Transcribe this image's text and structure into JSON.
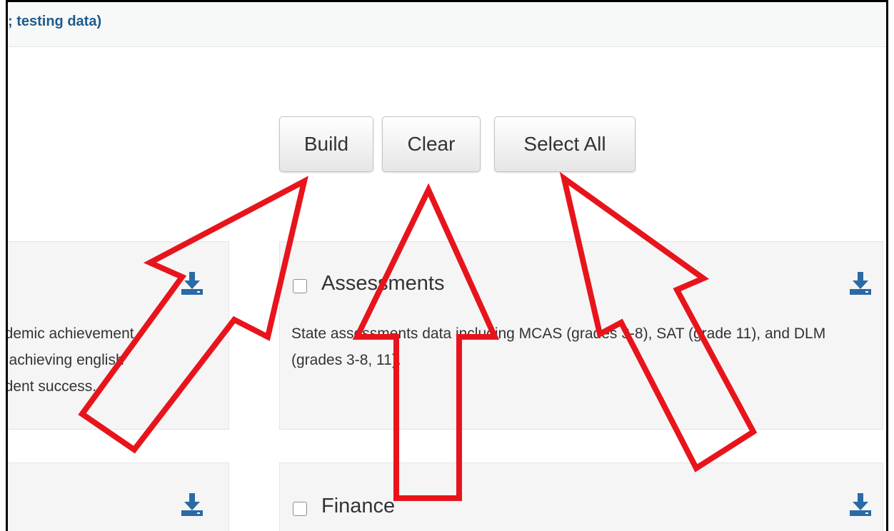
{
  "header": {
    "link_text": "; testing data)"
  },
  "actions": {
    "build_label": "Build",
    "clear_label": "Clear",
    "select_all_label": "Select All"
  },
  "cards": [
    {
      "title": "",
      "description_lines": [
        "ademic achievement,",
        "n achieving english",
        "udent success."
      ]
    },
    {
      "title": "Assessments",
      "description": "State assessments data including MCAS (grades 3-8), SAT (grade 11), and DLM (grades 3-8, 11)."
    },
    {
      "title": ""
    },
    {
      "title": "Finance"
    }
  ],
  "colors": {
    "link": "#1f5b8a",
    "download_icon": "#2a6aa5",
    "annotation_arrow": "#e8141c"
  },
  "icons": {
    "download": "download-icon",
    "annotation": "red-outline-arrow"
  }
}
